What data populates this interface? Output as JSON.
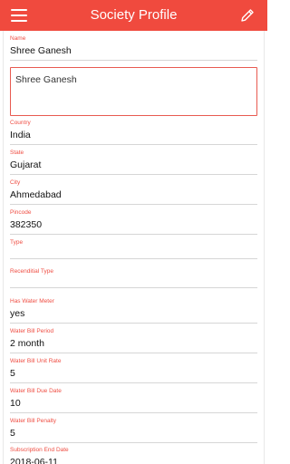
{
  "appbar": {
    "title": "Society Profile"
  },
  "icons": {
    "menu": "hamburger-menu-icon",
    "edit": "pencil-edit-icon"
  },
  "colors": {
    "primary": "#f04a3e",
    "label": "#ef4e43"
  },
  "form": {
    "name": {
      "label": "Name",
      "value": "Shree Ganesh"
    },
    "address": {
      "value": "Shree Ganesh"
    },
    "country": {
      "label": "Country",
      "value": "India"
    },
    "state": {
      "label": "State",
      "value": "Gujarat"
    },
    "city": {
      "label": "City",
      "value": "Ahmedabad"
    },
    "pincode": {
      "label": "Pincode",
      "value": "382350"
    },
    "type": {
      "label": "Type",
      "value": ""
    },
    "recenditial_type": {
      "label": "Recenditial Type",
      "value": ""
    },
    "has_water_meter": {
      "label": "Has Water Meter",
      "value": "yes"
    },
    "water_bill_period": {
      "label": "Water Bill Period",
      "value": "2 month"
    },
    "water_bill_unit_rate": {
      "label": "Water Bill Unit Rate",
      "value": "5"
    },
    "water_bill_due_date": {
      "label": "Water Bill Due Date",
      "value": "10"
    },
    "water_bill_penalty": {
      "label": "Water Bill Penalty",
      "value": "5"
    },
    "subscription_end_date": {
      "label": "Subscription End Date",
      "value": "2018-06-11"
    }
  }
}
